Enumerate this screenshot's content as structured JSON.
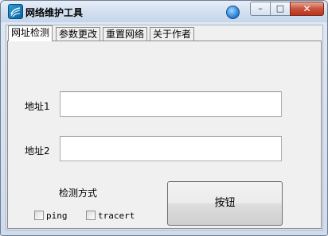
{
  "window": {
    "title": "网络维护工具"
  },
  "tabs": [
    {
      "label": "网址检测",
      "active": true
    },
    {
      "label": "参数更改",
      "active": false
    },
    {
      "label": "重置网络",
      "active": false
    },
    {
      "label": "关于作者",
      "active": false
    }
  ],
  "form": {
    "address1_label": "地址1",
    "address1_value": "",
    "address2_label": "地址2",
    "address2_value": "",
    "method_label": "检测方式",
    "option_ping": "ping",
    "option_tracert": "tracert",
    "button_label": "按钮"
  },
  "icons": {
    "app": "app-logo-icon",
    "globe": "globe-icon",
    "minimize": "minimize-icon",
    "maximize": "maximize-icon",
    "close": "close-icon"
  }
}
